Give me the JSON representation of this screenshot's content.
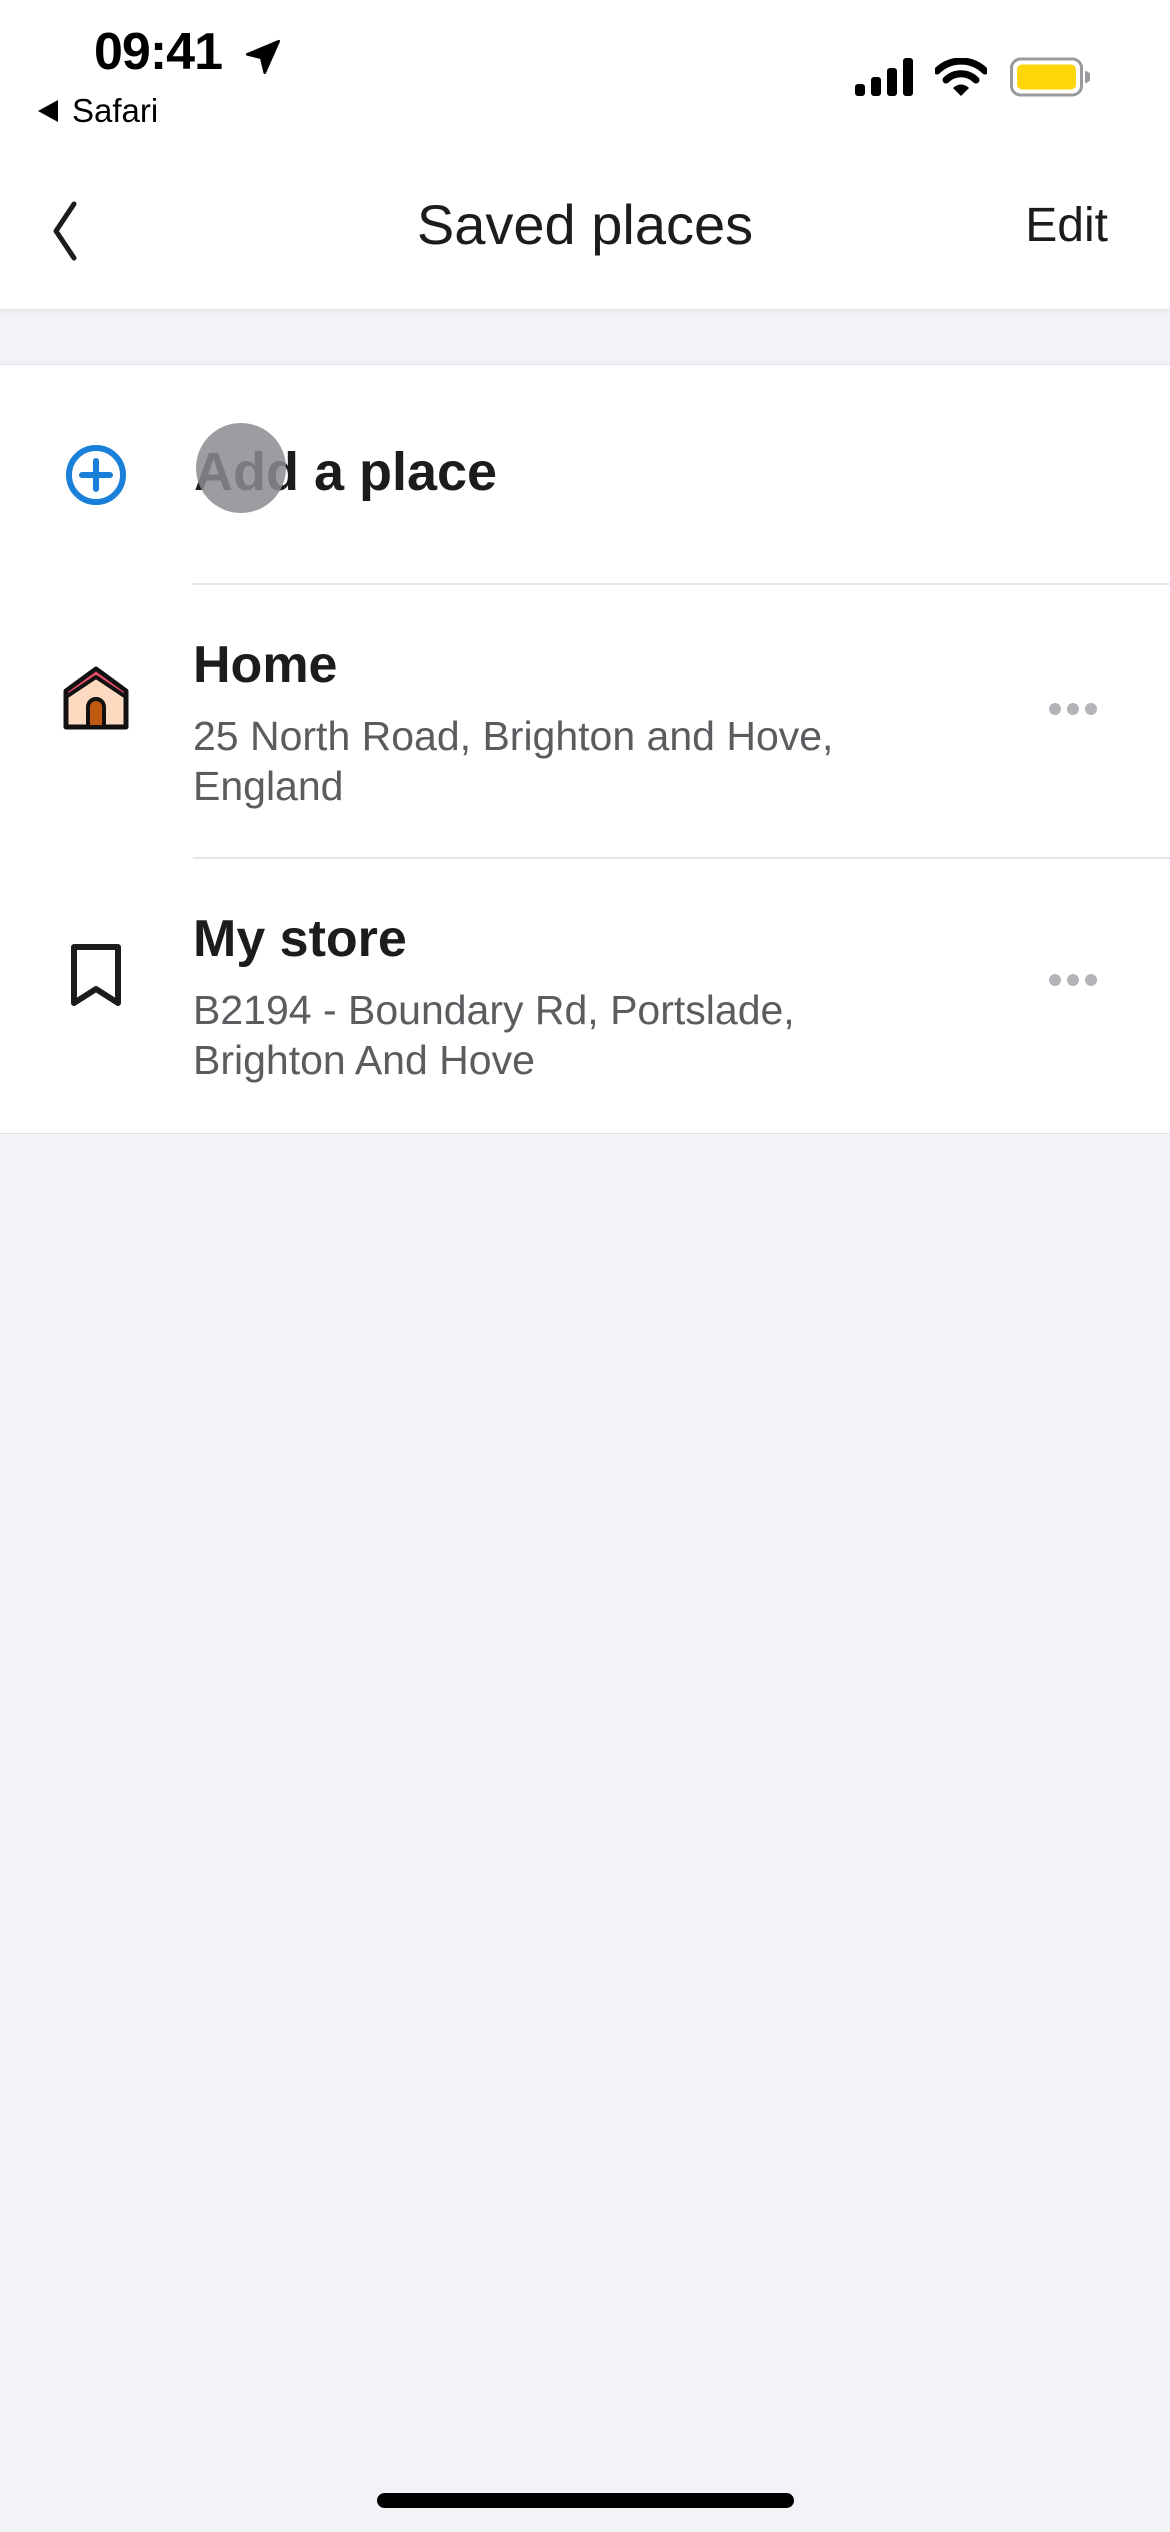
{
  "status_bar": {
    "time": "09:41",
    "back_app": "Safari",
    "location_icon": "location-arrow-icon",
    "signal_icon": "cellular-signal-icon",
    "wifi_icon": "wifi-icon",
    "battery_icon": "battery-icon",
    "battery_color": "#ffd60a"
  },
  "nav": {
    "back_icon": "chevron-left-icon",
    "title": "Saved places",
    "edit_label": "Edit"
  },
  "list": {
    "add_place": {
      "icon": "plus-circle-icon",
      "label": "Add a place",
      "accent": "#1a7fd8"
    },
    "places": [
      {
        "icon": "house-icon",
        "title": "Home",
        "address": "25 North Road, Brighton and Hove, England",
        "more_icon": "more-horizontal-icon"
      },
      {
        "icon": "bookmark-icon",
        "title": "My store",
        "address": "B2194 - Boundary Rd, Portslade, Brighton And Hove",
        "more_icon": "more-horizontal-icon"
      }
    ]
  }
}
